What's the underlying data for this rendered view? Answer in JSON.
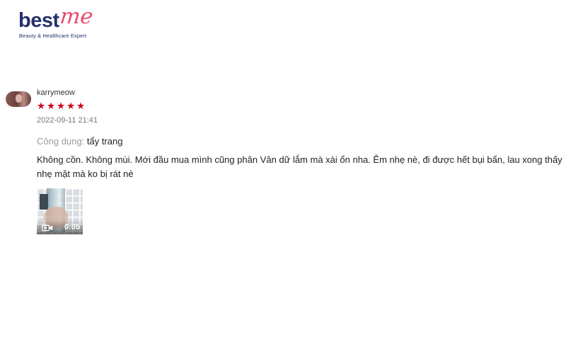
{
  "brand": {
    "logo_part1": "best",
    "logo_part2": "me",
    "tagline": "Beauty & Healthcare Expert",
    "colors": {
      "navy": "#25306b",
      "pink": "#e84a6c"
    }
  },
  "review": {
    "username": "karrymeow",
    "rating": 5,
    "stars": [
      "★",
      "★",
      "★",
      "★",
      "★"
    ],
    "star_color": "#d0011b",
    "timestamp": "2022-09-11 21:41",
    "usage_label": "Công dụng:",
    "usage_value": "tẩy trang",
    "comment": "Không cồn. Không mùi. Mới đầu mua mình cũng phân Vân dữ lắm mà xài ổn nha. Êm nhẹ nè, đi được hết bụi bẩn, lau xong thấy nhẹ mặt mà ko bị rát nè",
    "media": {
      "type": "video",
      "icon": "video-camera-icon",
      "duration": "0:05"
    }
  }
}
